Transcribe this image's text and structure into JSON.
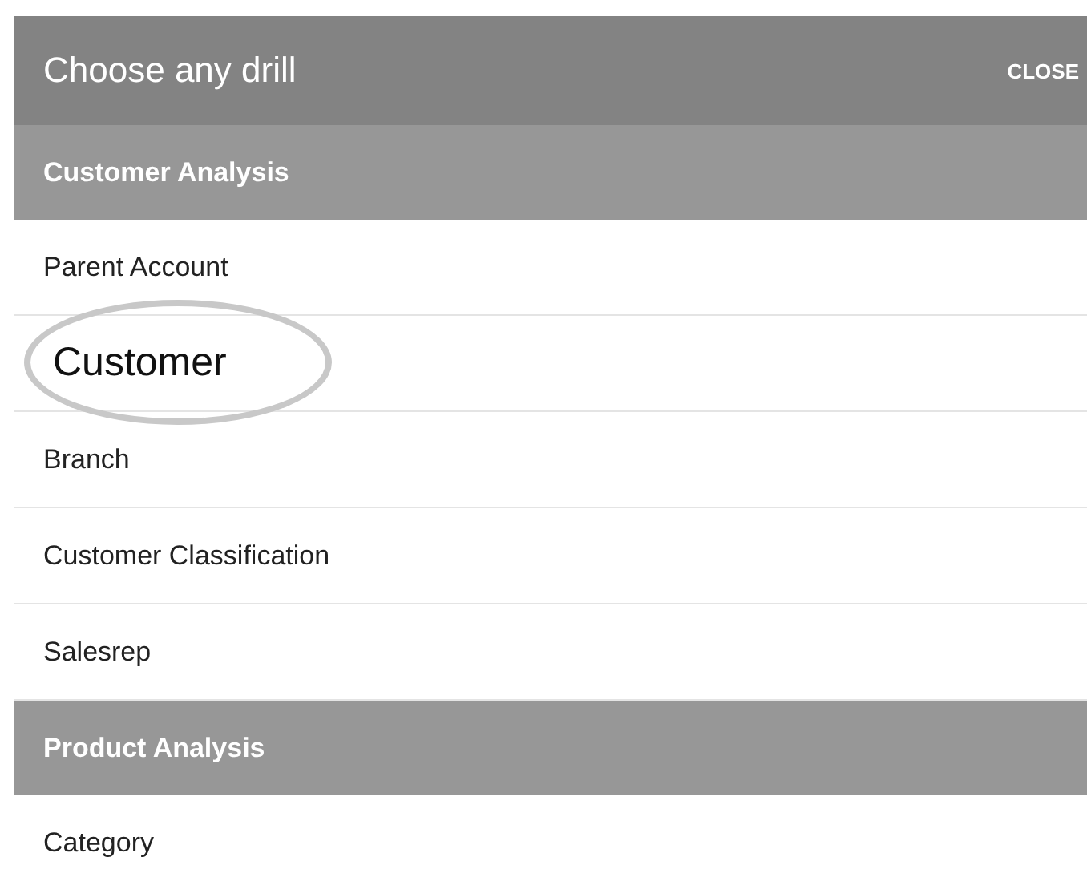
{
  "dialog": {
    "title": "Choose any drill",
    "close": "CLOSE"
  },
  "sections": [
    {
      "title": "Customer Analysis",
      "items": [
        {
          "label": "Parent Account",
          "highlighted": false
        },
        {
          "label": "Customer",
          "highlighted": true
        },
        {
          "label": "Branch",
          "highlighted": false
        },
        {
          "label": "Customer Classification",
          "highlighted": false
        },
        {
          "label": "Salesrep",
          "highlighted": false
        }
      ]
    },
    {
      "title": "Product Analysis",
      "items": [
        {
          "label": "Category",
          "highlighted": false
        }
      ]
    }
  ]
}
